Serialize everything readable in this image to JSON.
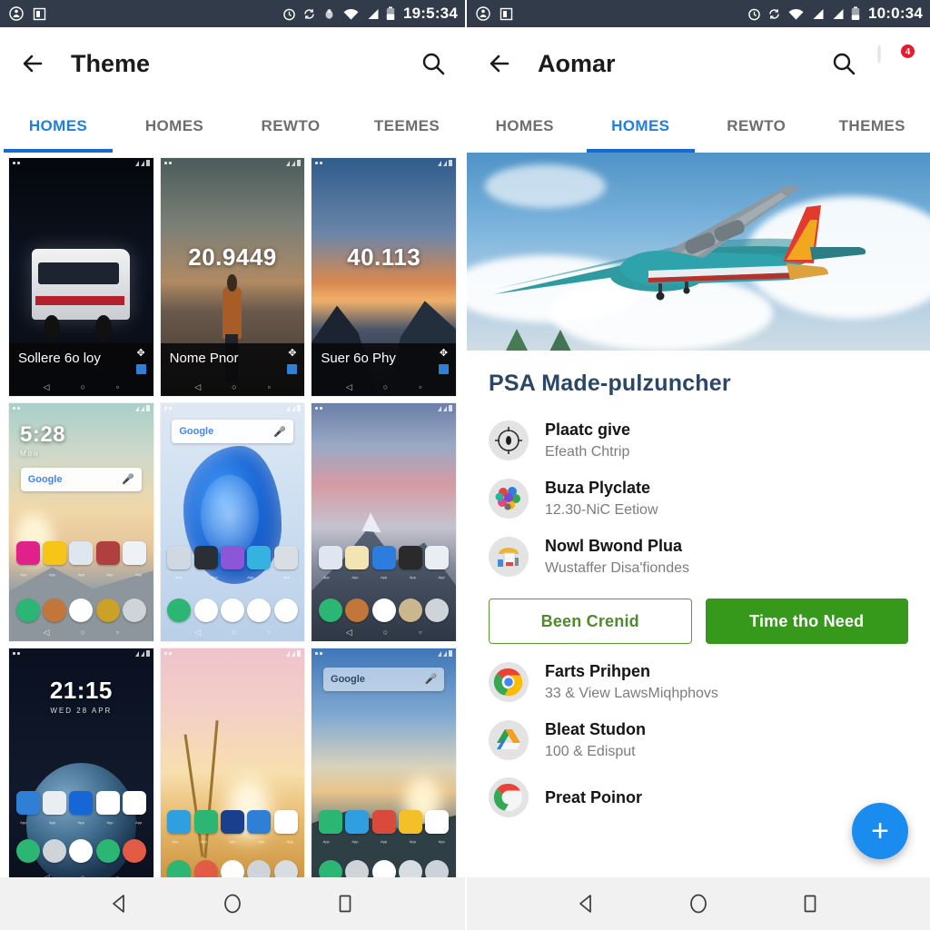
{
  "left": {
    "status_bar": {
      "time": "19:5:34",
      "left_icons": [
        "face-icon",
        "sim-card-icon"
      ],
      "right_icons": [
        "alarm-icon",
        "sync-icon",
        "bug-icon",
        "wifi-icon",
        "signal-icon",
        "battery-icon"
      ]
    },
    "appbar": {
      "back_icon": "back-arrow-icon",
      "title": "Theme",
      "search_icon": "search-icon"
    },
    "tabs": [
      {
        "label": "HOMES",
        "active": true
      },
      {
        "label": "HOMES",
        "active": false
      },
      {
        "label": "REWTO",
        "active": false
      },
      {
        "label": "TEEMES",
        "active": false
      }
    ],
    "thumbnails": [
      {
        "caption": "Sollere 6o loy",
        "clock": "",
        "sub": "",
        "kind": "van-night"
      },
      {
        "caption": "Nome Pnor",
        "clock": "20.9449",
        "sub": "",
        "kind": "lake-person"
      },
      {
        "caption": "Suer 6o Phy",
        "clock": "40.113",
        "sub": "",
        "kind": "fjord-sunset"
      },
      {
        "caption": "",
        "clock": "5:28",
        "sub": "Mon",
        "kind": "sunrise-hills",
        "search": "Google"
      },
      {
        "caption": "",
        "clock": "",
        "sub": "",
        "kind": "blue-swirl",
        "search": "Google"
      },
      {
        "caption": "",
        "clock": "",
        "sub": "",
        "kind": "mountain-dusk"
      },
      {
        "caption": "",
        "clock": "21:15",
        "sub": "WED 28 APR",
        "kind": "earth-space"
      },
      {
        "caption": "",
        "clock": "",
        "sub": "",
        "kind": "wheat-sunset"
      },
      {
        "caption": "",
        "clock": "",
        "sub": "",
        "kind": "lake-sunrise",
        "search": "Google"
      }
    ],
    "navbar": [
      "back-triangle-icon",
      "home-circle-icon",
      "recents-square-icon"
    ]
  },
  "right": {
    "status_bar": {
      "time": "10:0:34",
      "left_icons": [
        "face-icon",
        "sim-card-icon"
      ],
      "right_icons": [
        "alarm-icon",
        "sync-icon",
        "wifi-icon",
        "signal-icon",
        "signal2-icon",
        "battery-icon"
      ]
    },
    "appbar": {
      "back_icon": "back-arrow-icon",
      "title": "Aomar",
      "search_icon": "search-icon",
      "avatar": "user-avatar",
      "badge_count": "4"
    },
    "tabs": [
      {
        "label": "HOMES",
        "active": false
      },
      {
        "label": "HOMES",
        "active": true
      },
      {
        "label": "REWTO",
        "active": false
      },
      {
        "label": "THEMES",
        "active": false
      }
    ],
    "hero": {
      "alt": "airplane-photo"
    },
    "section_title": "PSA  Made-pulzuncher",
    "list_top": [
      {
        "icon": "compass-icon",
        "title": "Plaatc give",
        "subtitle": "Efeath Chtrip"
      },
      {
        "icon": "app-cluster-icon",
        "title": "Buza Plyclate",
        "subtitle": "12.30-NiC Eetiow"
      },
      {
        "icon": "toolbox-icon",
        "title": "Nowl Bwond Plua",
        "subtitle": "Wustaffer Disa'fiondes"
      }
    ],
    "buttons": {
      "secondary": "Been Crenid",
      "primary": "Time tho Need"
    },
    "list_bottom": [
      {
        "icon": "chrome-icon",
        "title": "Farts Prihpen",
        "subtitle": "33 & View LawsMiqhphovs"
      },
      {
        "icon": "drive-icon",
        "title": "Bleat Studon",
        "subtitle": "100 & Edisput"
      },
      {
        "icon": "chrome-icon",
        "title": "Preat Poinor",
        "subtitle": ""
      }
    ],
    "fab": {
      "icon": "plus-icon",
      "label": "+"
    },
    "navbar": [
      "back-triangle-icon",
      "home-circle-icon",
      "recents-square-icon"
    ]
  },
  "colors": {
    "status_bar_bg": "#323b49",
    "accent_blue": "#1668d4",
    "tab_active": "#1d7fe0",
    "primary_green": "#37991c",
    "outline_green": "#5b9b2e",
    "fab_blue": "#1a8cf0",
    "badge_red": "#e8192c",
    "title_navy": "#2a4766"
  }
}
